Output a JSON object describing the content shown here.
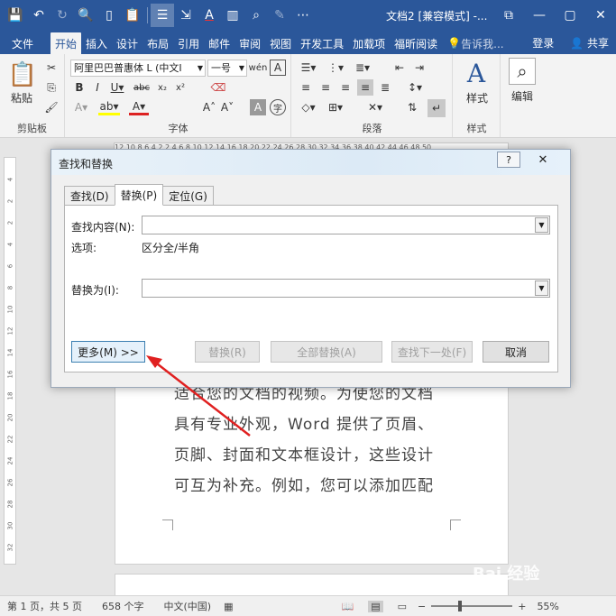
{
  "window": {
    "doc_title": "文档2 [兼容模式] -...",
    "qat_icons": [
      "save-icon",
      "undo-icon",
      "redo-icon",
      "print-preview-icon",
      "new-doc-icon",
      "paste-icon",
      "layout-icon",
      "format-icon",
      "font-color-icon",
      "columns-icon",
      "find-icon",
      "pen-icon",
      "more-icon"
    ]
  },
  "ribbon_tabs": [
    "文件",
    "开始",
    "插入",
    "设计",
    "布局",
    "引用",
    "邮件",
    "审阅",
    "视图",
    "开发工具",
    "加载项",
    "福昕阅读"
  ],
  "active_tab": "开始",
  "tell_me": "告诉我...",
  "sign_in": "登录",
  "share": "共享",
  "ribbon": {
    "clipboard": {
      "paste_label": "粘贴",
      "group_label": "剪贴板"
    },
    "font": {
      "font_name": "阿里巴巴普惠体 L (中文I",
      "font_size": "一号",
      "group_label": "字体"
    },
    "paragraph": {
      "group_label": "段落"
    },
    "styles": {
      "label": "样式",
      "group_label": "样式"
    },
    "editing": {
      "label": "编辑"
    }
  },
  "ruler_numbers": "12 10 8 6 4 2 2 4 6 8 10 12 14 16 18 20 22 24 26 28 30 32 34 36 38 40 42 44 46 48 50",
  "ruler_right_numbers": "42 44 46",
  "left_ruler_marks": [
    "4",
    "2",
    "2",
    "4",
    "6",
    "8",
    "10",
    "12",
    "14",
    "16",
    "18",
    "20",
    "22",
    "24",
    "26",
    "28",
    "30",
    "32"
  ],
  "document_lines": [
    "适合您的文档的视频。为使您的文档",
    "具有专业外观，Word 提供了页眉、",
    "页脚、封面和文本框设计，这些设计",
    "可互为补充。例如，您可以添加匹配"
  ],
  "dialog": {
    "title": "查找和替换",
    "help": "?",
    "close": "✕",
    "tabs": [
      "查找(D)",
      "替换(P)",
      "定位(G)"
    ],
    "active_tab": "替换(P)",
    "find_label": "查找内容(N):",
    "find_value": "",
    "options_label": "选项:",
    "options_value": "区分全/半角",
    "replace_label": "替换为(I):",
    "replace_value": "",
    "more_button": "更多(M) >>",
    "replace_button": "替换(R)",
    "replace_all_button": "全部替换(A)",
    "find_next_button": "查找下一处(F)",
    "cancel_button": "取消"
  },
  "status": {
    "page": "第 1 页，共 5 页",
    "words": "658 个字",
    "lang": "中文(中国)",
    "zoom": "55%"
  },
  "watermark": "Bai 经验"
}
